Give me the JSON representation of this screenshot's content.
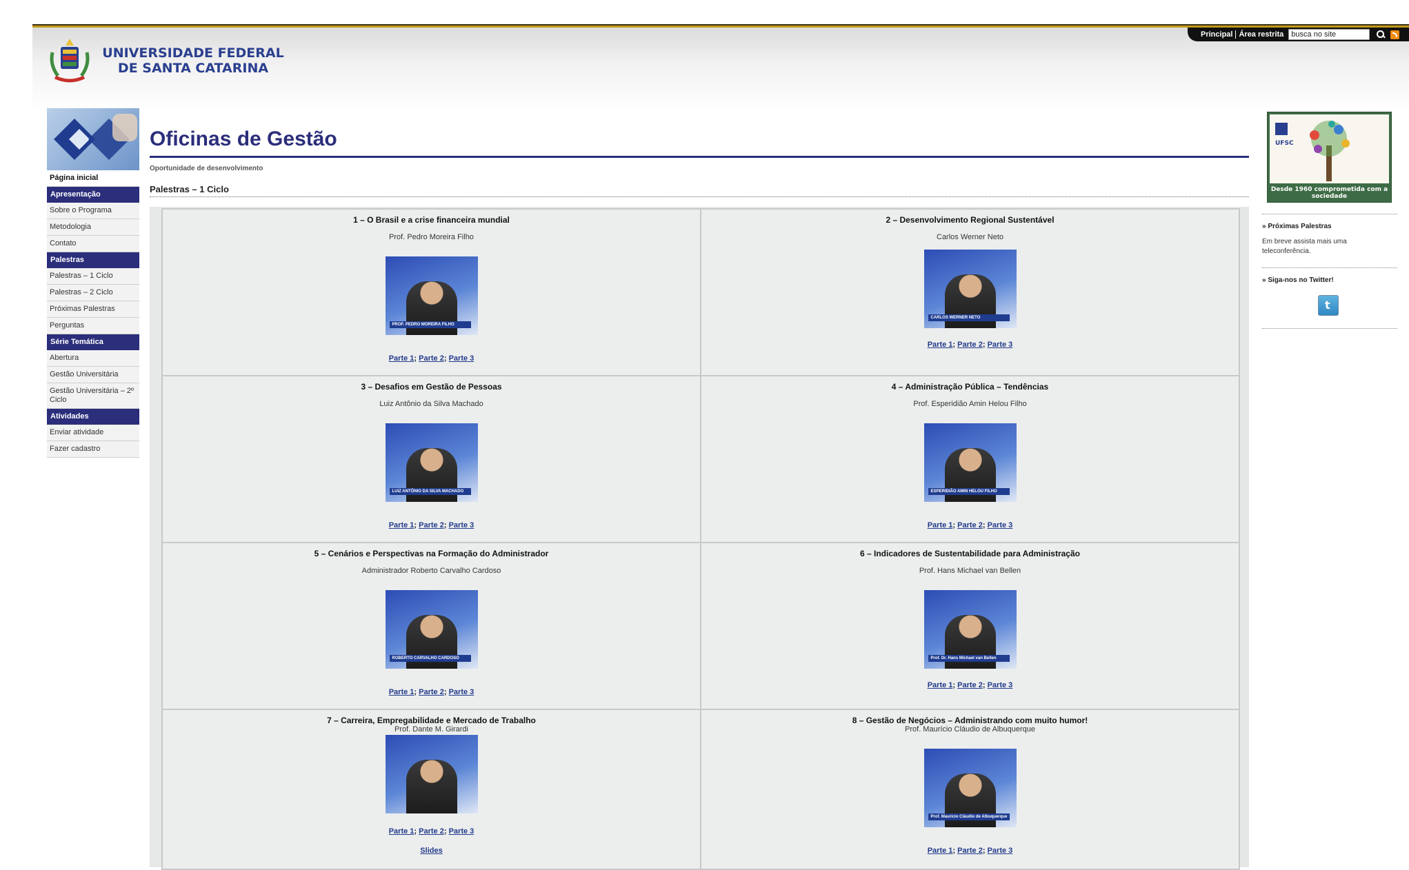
{
  "header": {
    "university_line1": "UNIVERSIDADE FEDERAL",
    "university_line2": "DE SANTA CATARINA",
    "links": [
      "Principal",
      "Área restrita"
    ],
    "search_value": "busca no site"
  },
  "sidebar": {
    "first": "Página inicial",
    "sections": [
      {
        "header": "Apresentação",
        "items": [
          "Sobre o Programa",
          "Metodologia",
          "Contato"
        ]
      },
      {
        "header": "Palestras",
        "items": [
          "Palestras – 1 Ciclo",
          "Palestras – 2 Ciclo",
          "Próximas Palestras",
          "Perguntas"
        ]
      },
      {
        "header": "Série Temática",
        "items": [
          "Abertura",
          "Gestão Universitária",
          "Gestão Universitária – 2º Ciclo"
        ]
      },
      {
        "header": "Atividades",
        "items": [
          "Enviar atividade",
          "Fazer cadastro"
        ]
      }
    ]
  },
  "main": {
    "title": "Oficinas de Gestão",
    "subtitle": "Oportunidade de desenvolvimento",
    "section": "Palestras – 1 Ciclo",
    "separator": ";",
    "lectures": [
      {
        "title": "1 – O Brasil e a crise financeira mundial",
        "presenter": "Prof. Pedro Moreira Filho",
        "caption": "PROF. PEDRO MOREIRA FILHO",
        "parts": [
          "Parte 1",
          "Parte 2",
          "Parte 3"
        ]
      },
      {
        "title": "2 – Desenvolvimento Regional Sustentável",
        "presenter": "Carlos Werner Neto",
        "caption": "CARLOS WERNER NETO",
        "parts": [
          "Parte 1",
          "Parte 2",
          "Parte 3"
        ]
      },
      {
        "title": "3 – Desafios em Gestão de Pessoas",
        "presenter": "Luiz Antônio da Silva Machado",
        "caption": "LUIZ ANTÔNIO DA SILVA MACHADO",
        "parts": [
          "Parte 1",
          "Parte 2",
          "Parte 3"
        ]
      },
      {
        "title": "4 – Administração Pública – Tendências",
        "presenter": "Prof. Esperidião Amin Helou Filho",
        "caption": "ESPERIDIÃO AMIN HELOU FILHO",
        "parts": [
          "Parte 1",
          "Parte 2",
          "Parte 3"
        ]
      },
      {
        "title": "5 – Cenários e Perspectivas na Formação do Administrador",
        "presenter": "Administrador Roberto Carvalho Cardoso",
        "caption": "ROBERTO CARVALHO CARDOSO",
        "parts": [
          "Parte 1",
          "Parte 2",
          "Parte 3"
        ]
      },
      {
        "title": "6 – Indicadores de Sustentabilidade para Administração",
        "presenter": "Prof. Hans Michael van Bellen",
        "caption": "Prof. Dr. Hans Michael van Bellen",
        "parts": [
          "Parte 1",
          "Parte 2",
          "Parte 3"
        ]
      },
      {
        "title": "7 – Carreira, Empregabilidade e Mercado de Trabalho",
        "presenter": "Prof. Dante M. Girardi",
        "caption": "",
        "parts": [
          "Parte 1",
          "Parte 2",
          "Parte 3"
        ],
        "slides": "Slides"
      },
      {
        "title": "8 – Gestão de Negócios – Administrando com muito humor!",
        "presenter": "Prof. Maurício Cláudio de Albuquerque",
        "caption": "Prof. Maurício Cláudio de Albuquerque",
        "parts": [
          "Parte 1",
          "Parte 2",
          "Parte 3"
        ]
      }
    ]
  },
  "right": {
    "banner_label": "UFSC",
    "banner_caption": "Desde 1960 comprometida com a sociedade",
    "box1_title": "» Próximas Palestras",
    "box1_text": "Em breve assista mais uma teleconferência.",
    "box2_title": "» Siga-nos no Twitter!"
  },
  "colors": {
    "brand_navy": "#2b2e7a",
    "header_gold": "#c29a1c",
    "link": "#223a8a"
  }
}
